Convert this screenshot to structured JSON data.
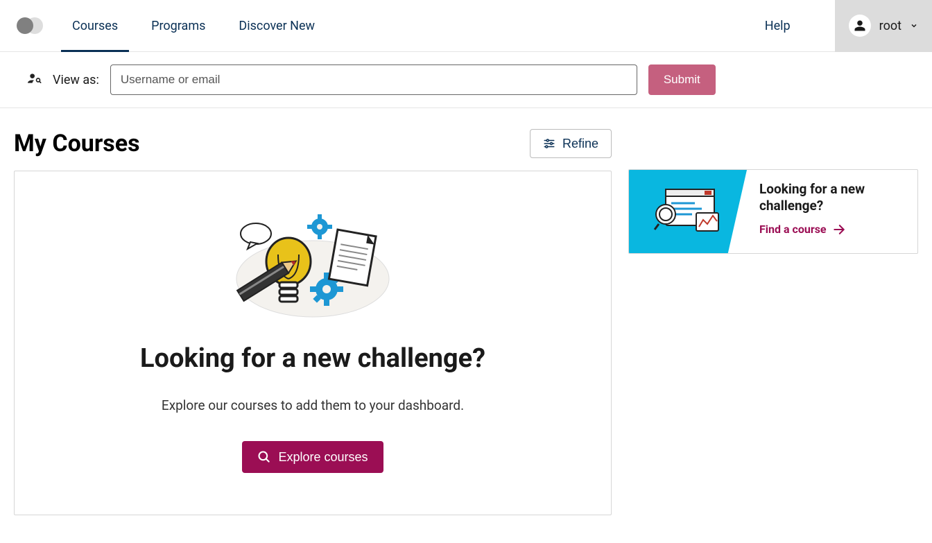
{
  "nav": {
    "courses": "Courses",
    "programs": "Programs",
    "discover": "Discover New",
    "help": "Help"
  },
  "user": {
    "name": "root"
  },
  "viewas": {
    "label": "View as:",
    "placeholder": "Username or email",
    "submit": "Submit"
  },
  "page": {
    "title": "My Courses",
    "refine": "Refine"
  },
  "empty": {
    "title": "Looking for a new challenge?",
    "subtitle": "Explore our courses to add them to your dashboard.",
    "cta": "Explore courses"
  },
  "promo": {
    "title": "Looking for a new challenge?",
    "link": "Find a course"
  }
}
